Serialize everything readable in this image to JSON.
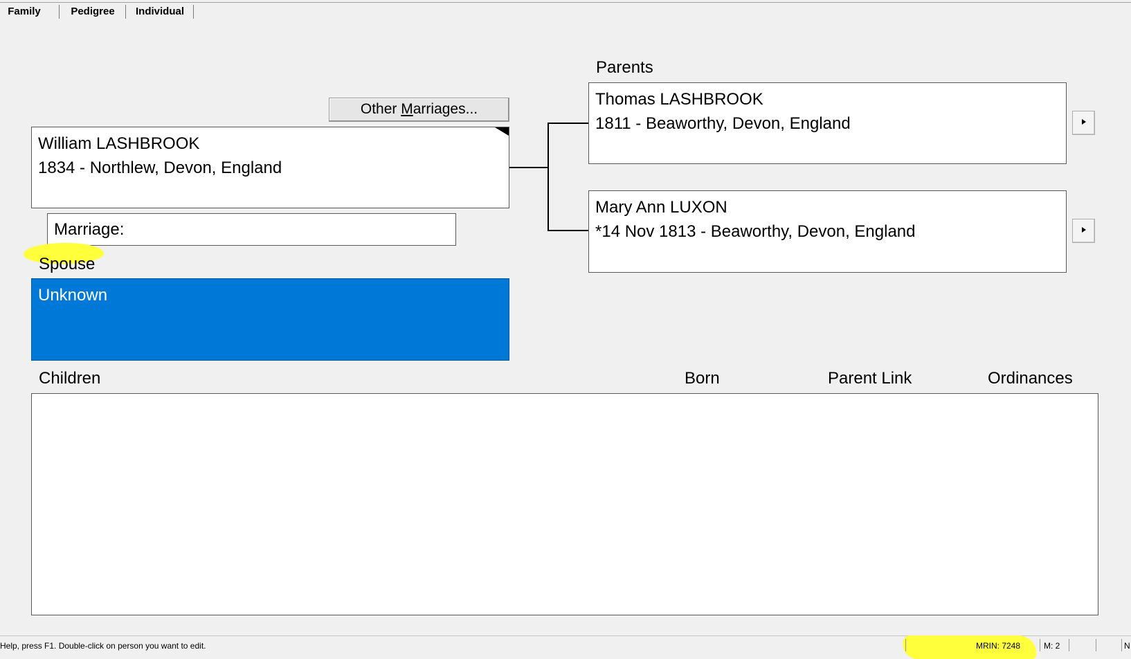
{
  "tabs": [
    {
      "label": "Family"
    },
    {
      "label": "Pedigree"
    },
    {
      "label": "Individual"
    }
  ],
  "individual": {
    "name": "William LASHBROOK",
    "details": "1834 - Northlew, Devon, England"
  },
  "other_marriages": {
    "label_before": "Other ",
    "label_mnemonic": "M",
    "label_after": "arriages..."
  },
  "marriage": {
    "label": "Marriage:"
  },
  "spouse": {
    "section_label": "Spouse",
    "name": "Unknown"
  },
  "parents": {
    "section_label": "Parents",
    "father": {
      "name": "Thomas LASHBROOK",
      "details": "1811 - Beaworthy, Devon, England"
    },
    "mother": {
      "name": "Mary Ann LUXON",
      "details": "*14 Nov 1813 - Beaworthy, Devon, England"
    }
  },
  "children": {
    "columns": [
      "Children",
      "Born",
      "Parent Link",
      "Ordinances"
    ]
  },
  "status_bar": {
    "help_text": "Help, press F1. Double-click on person you want to edit.",
    "mrin": "MRIN: 7248",
    "marriages_count": "M: 2",
    "last_pane": "N"
  },
  "colors": {
    "selected_box": "#0078d7",
    "highlight": "#ffff3c"
  },
  "icons": {
    "parent_arrow": "triangle-right-icon",
    "corner_flag": "corner-triangle-icon"
  }
}
